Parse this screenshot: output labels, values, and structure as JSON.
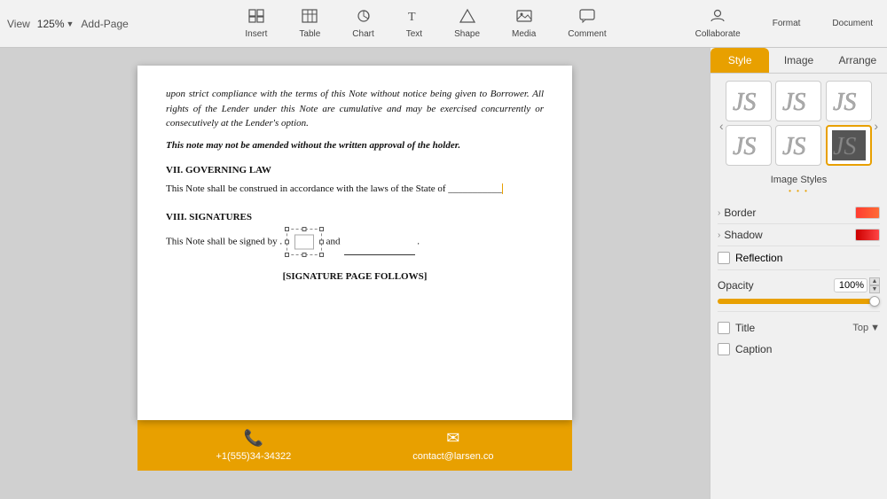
{
  "toolbar": {
    "view_label": "View",
    "zoom_value": "125%",
    "add_page_label": "Add-Page",
    "tools": [
      {
        "id": "insert",
        "icon": "⊞",
        "label": "Insert"
      },
      {
        "id": "table",
        "icon": "⊟",
        "label": "Table"
      },
      {
        "id": "chart",
        "icon": "◎",
        "label": "Chart"
      },
      {
        "id": "text",
        "icon": "T",
        "label": "Text"
      },
      {
        "id": "shape",
        "icon": "◇",
        "label": "Shape"
      },
      {
        "id": "media",
        "icon": "▣",
        "label": "Media"
      },
      {
        "id": "comment",
        "icon": "💬",
        "label": "Comment"
      }
    ],
    "right_tools": [
      {
        "id": "collaborate",
        "icon": "⊕",
        "label": "Collaborate"
      },
      {
        "id": "format",
        "label": "Format"
      },
      {
        "id": "document",
        "label": "Document"
      }
    ]
  },
  "document": {
    "paragraphs": [
      {
        "id": "p1",
        "text": "upon strict compliance with the terms of this Note without notice being  given to Borrower. All rights of the Lender under this Note are cumulative  and  may be exercised concurrently or consecutively at the Lender's option.",
        "style": "normal"
      },
      {
        "id": "p2",
        "text": "This note may not be amended without the written approval of the holder.",
        "style": "italic-bold"
      },
      {
        "id": "sec7",
        "text": "VII. GOVERNING LAW",
        "style": "bold"
      },
      {
        "id": "p3",
        "text": "This Note shall be construed in accordance with the laws of the State of",
        "style": "normal"
      },
      {
        "id": "sec8",
        "text": "VIII. SIGNATURES",
        "style": "bold"
      },
      {
        "id": "sig_page",
        "text": "[SIGNATURE PAGE FOLLOWS]",
        "style": "centered-bold"
      }
    ],
    "signature_text_before": "This Note shall be signed by .",
    "signature_text_after": "and",
    "footer": {
      "phone_icon": "📞",
      "phone": "+1(555)34-34322",
      "email_icon": "✉",
      "email": "contact@larsen.co"
    }
  },
  "right_panel": {
    "tabs": [
      "Style",
      "Image",
      "Arrange"
    ],
    "active_tab": "Style",
    "image_styles_label": "Image Styles",
    "style_dots": "• • •",
    "styles": [
      {
        "id": 1,
        "selected": false
      },
      {
        "id": 2,
        "selected": false
      },
      {
        "id": 3,
        "selected": false
      },
      {
        "id": 4,
        "selected": false
      },
      {
        "id": 5,
        "selected": false
      },
      {
        "id": 6,
        "selected": false
      }
    ],
    "border_label": "Border",
    "shadow_label": "Shadow",
    "reflection_label": "Reflection",
    "opacity_label": "Opacity",
    "opacity_value": "100%",
    "title_label": "Title",
    "caption_label": "Caption",
    "title_position": "Top"
  }
}
